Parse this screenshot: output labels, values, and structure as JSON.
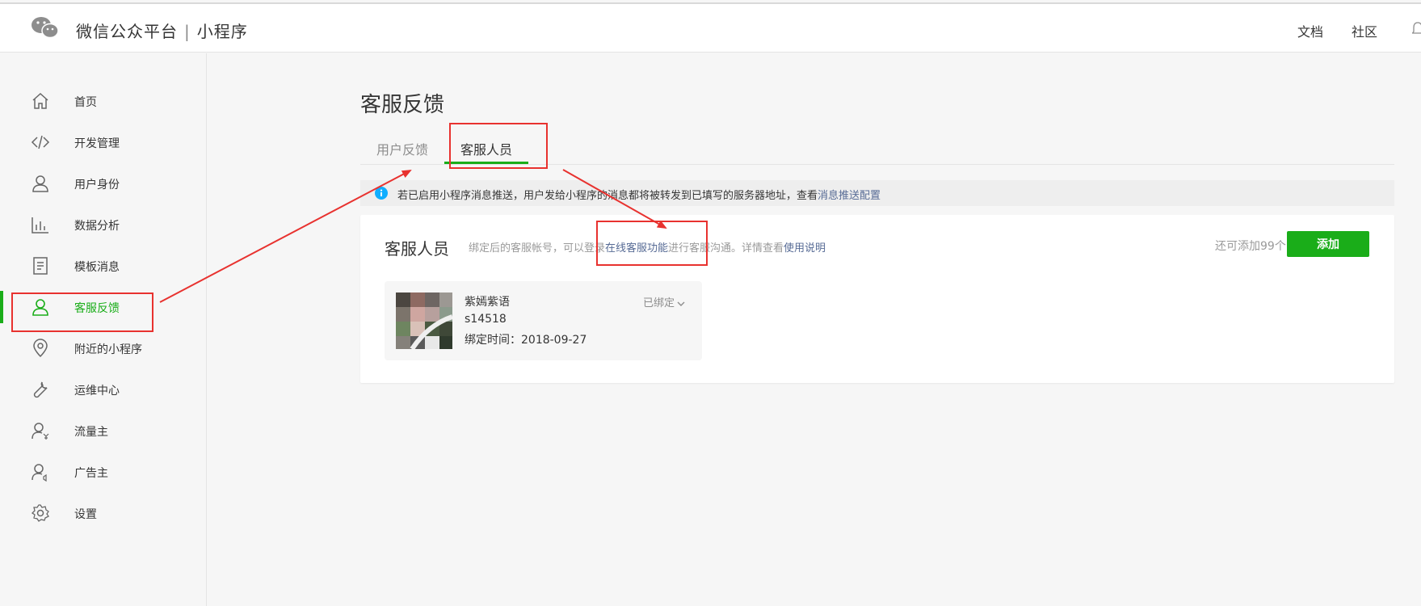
{
  "header": {
    "brand_name": "微信公众平台",
    "brand_separator": "|",
    "brand_product": "小程序",
    "nav_docs": "文档",
    "nav_community": "社区"
  },
  "sidebar": {
    "items": [
      {
        "label": "首页",
        "icon": "home-icon"
      },
      {
        "label": "开发管理",
        "icon": "code-icon"
      },
      {
        "label": "用户身份",
        "icon": "user-icon"
      },
      {
        "label": "数据分析",
        "icon": "chart-icon"
      },
      {
        "label": "模板消息",
        "icon": "document-icon"
      },
      {
        "label": "客服反馈",
        "icon": "user-icon",
        "active": true
      },
      {
        "label": "附近的小程序",
        "icon": "location-pin-icon"
      },
      {
        "label": "运维中心",
        "icon": "wrench-icon"
      },
      {
        "label": "流量主",
        "icon": "user-yen-icon"
      },
      {
        "label": "广告主",
        "icon": "user-speaker-icon"
      },
      {
        "label": "设置",
        "icon": "gear-icon"
      }
    ]
  },
  "main": {
    "title": "客服反馈",
    "tabs": [
      {
        "label": "用户反馈",
        "active": false
      },
      {
        "label": "客服人员",
        "active": true
      }
    ],
    "notice": {
      "text": "若已启用小程序消息推送，用户发给小程序的消息都将被转发到已填写的服务器地址，查看",
      "link": "消息推送配置"
    },
    "card": {
      "title": "客服人员",
      "desc_prefix": "绑定后的客服帐号，可以登录",
      "desc_link": "在线客服功能",
      "desc_middle": "进行客服沟通。详情查看",
      "desc_link2": "使用说明",
      "remaining": "还可添加99个",
      "add_label": "添加"
    },
    "member": {
      "name": "紫嫣紫语",
      "id": "s14518",
      "bind_time": "绑定时间：2018-09-27",
      "status": "已绑定"
    }
  },
  "colors": {
    "accent": "#1aad19",
    "link": "#576b95",
    "annotation": "#e8322f"
  }
}
